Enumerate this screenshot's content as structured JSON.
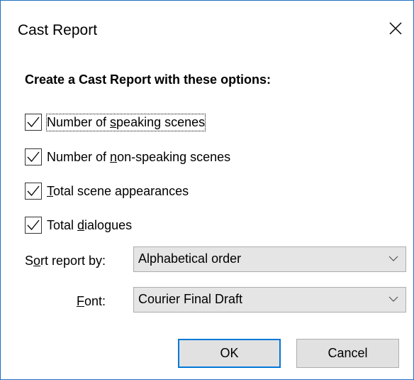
{
  "window": {
    "title": "Cast Report"
  },
  "heading": "Create a Cast Report with these options:",
  "options": [
    {
      "pre": "Number of ",
      "accel": "s",
      "post": "peaking scenes",
      "checked": true
    },
    {
      "pre": "Number of ",
      "accel": "n",
      "post": "on-speaking scenes",
      "checked": true
    },
    {
      "pre": "",
      "accel": "T",
      "post": "otal scene appearances",
      "checked": true
    },
    {
      "pre": "Total ",
      "accel": "d",
      "post": "ialogues",
      "checked": true
    }
  ],
  "sort": {
    "label_pre": "S",
    "label_accel": "o",
    "label_post": "rt report by:",
    "value": "Alphabetical order"
  },
  "font": {
    "label_pre": "",
    "label_accel": "F",
    "label_post": "ont:",
    "value": "Courier Final Draft"
  },
  "buttons": {
    "ok": "OK",
    "cancel": "Cancel"
  },
  "icons": {
    "close": "close-icon",
    "check": "checkmark-icon",
    "dropdown": "chevron-down-icon"
  },
  "colors": {
    "window_border": "#1e6fbf",
    "default_button_border": "#0078d7",
    "control_bg": "#e5e5e5"
  }
}
